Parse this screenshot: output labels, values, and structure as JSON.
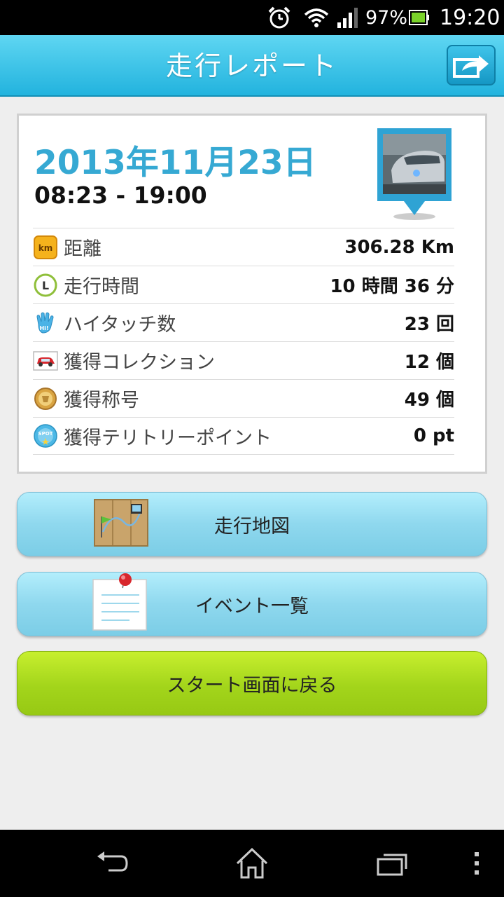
{
  "status_bar": {
    "battery_percent": "97%",
    "time": "19:20",
    "icons": [
      "alarm-clock-icon",
      "wifi-icon",
      "signal-icon",
      "battery-icon"
    ]
  },
  "header": {
    "title": "走行レポート",
    "share_icon": "share-icon"
  },
  "report": {
    "date": "2013年11月23日",
    "time_range": "08:23 - 19:00",
    "rows": [
      {
        "icon": "distance-km-icon",
        "icon_text": "km",
        "label": "距離",
        "value": "306.28 Km"
      },
      {
        "icon": "clock-icon",
        "icon_text": "L",
        "label": "走行時間",
        "value": "10 時間 36 分"
      },
      {
        "icon": "hand-hi-icon",
        "icon_text": "Hi!",
        "label": "ハイタッチ数",
        "value": "23 回"
      },
      {
        "icon": "car-card-icon",
        "label": "獲得コレクション",
        "value": "12 個"
      },
      {
        "icon": "medal-icon",
        "label": "獲得称号",
        "value": "49 個"
      },
      {
        "icon": "spot-icon",
        "icon_text": "SPOT",
        "label": "獲得テリトリーポイント",
        "value": "0 pt"
      }
    ]
  },
  "buttons": {
    "map": "走行地図",
    "events": "イベント一覧",
    "back_to_start": "スタート画面に戻る"
  },
  "colors": {
    "header": "#2ab8e2",
    "date_text": "#36a9d3",
    "blue_button": "#8fd8ee",
    "green_button": "#a3d51b"
  }
}
